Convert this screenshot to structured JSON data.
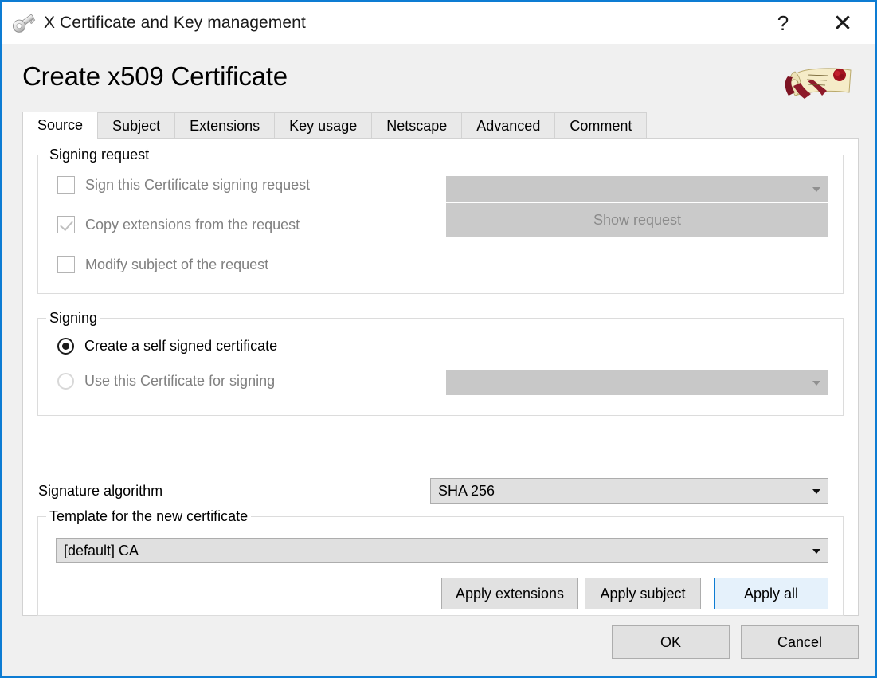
{
  "window": {
    "title": "X Certificate and Key management",
    "app_icon": "key-icon",
    "help_label": "?",
    "close_label": "✕",
    "border_color": "#0d7cd3"
  },
  "page": {
    "title": "Create x509 Certificate",
    "decoration_icon": "certificate-scroll-icon"
  },
  "tabs": [
    {
      "label": "Source",
      "active": true
    },
    {
      "label": "Subject",
      "active": false
    },
    {
      "label": "Extensions",
      "active": false
    },
    {
      "label": "Key usage",
      "active": false
    },
    {
      "label": "Netscape",
      "active": false
    },
    {
      "label": "Advanced",
      "active": false
    },
    {
      "label": "Comment",
      "active": false
    }
  ],
  "signing_request": {
    "group_title": "Signing request",
    "sign_csr": {
      "label": "Sign this Certificate signing request",
      "checked": false,
      "disabled": true
    },
    "copy_extensions": {
      "label": "Copy extensions from the request",
      "checked": true,
      "disabled": true
    },
    "modify_subject": {
      "label": "Modify subject of the request",
      "checked": false,
      "disabled": true
    },
    "request_combo": {
      "value": "",
      "disabled": true
    },
    "show_request_button": {
      "label": "Show request",
      "disabled": true
    }
  },
  "signing": {
    "group_title": "Signing",
    "self_signed": {
      "label": "Create a self signed certificate",
      "selected": true,
      "disabled": false
    },
    "use_certificate": {
      "label": "Use this Certificate for signing",
      "selected": false,
      "disabled": true
    },
    "signer_combo": {
      "value": "",
      "disabled": true
    }
  },
  "signature_algorithm": {
    "label": "Signature algorithm",
    "value": "SHA 256",
    "disabled": false
  },
  "template": {
    "group_title": "Template for the new certificate",
    "value": "[default] CA",
    "buttons": {
      "apply_extensions": "Apply extensions",
      "apply_subject": "Apply subject",
      "apply_all": "Apply all"
    }
  },
  "footer": {
    "ok_label": "OK",
    "cancel_label": "Cancel"
  },
  "colors": {
    "accent": "#0d7cd3",
    "default_button_fill": "#e5f1fb",
    "dialog_background": "#f0f0f0",
    "panel_background": "#ffffff",
    "disabled_text": "#808080"
  }
}
